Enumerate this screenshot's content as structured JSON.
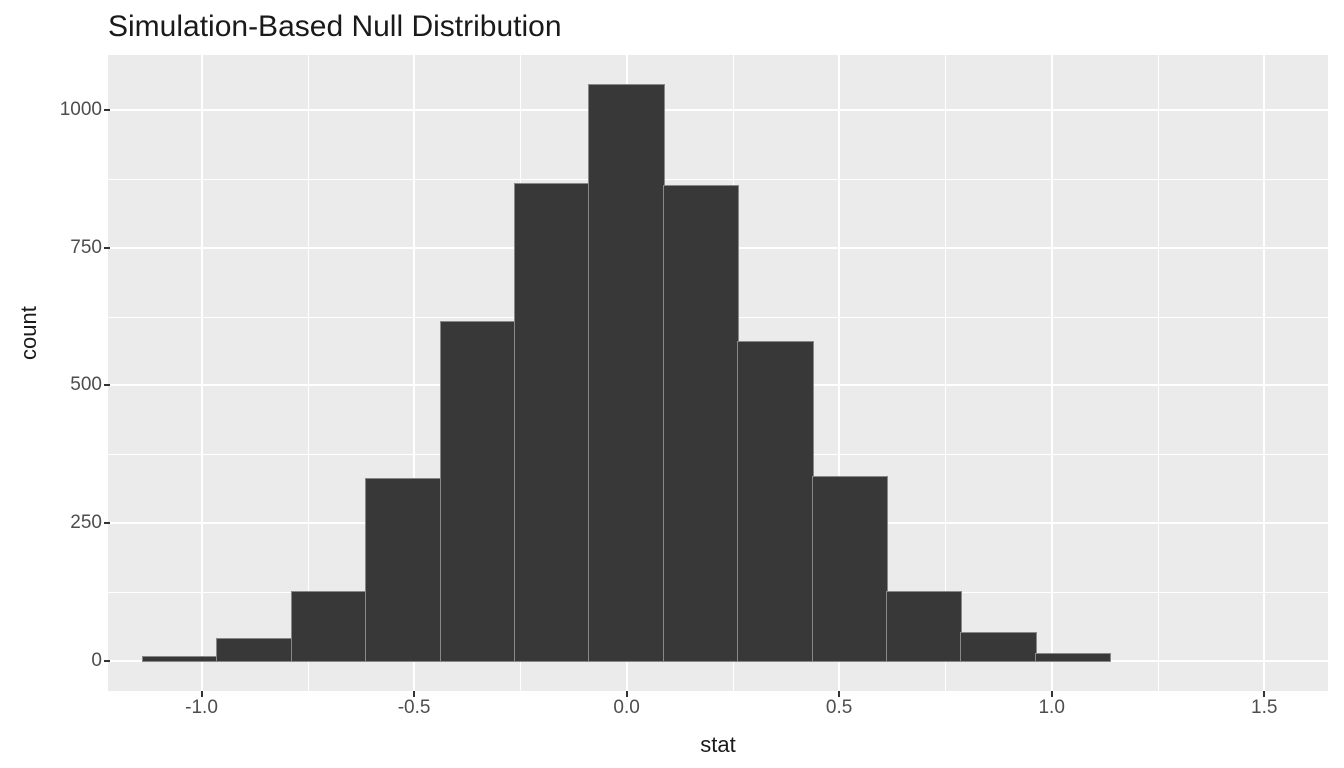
{
  "chart_data": {
    "type": "bar",
    "title": "Simulation-Based Null Distribution",
    "xlabel": "stat",
    "ylabel": "count",
    "xlim": [
      -1.22,
      1.65
    ],
    "ylim": [
      -55,
      1100
    ],
    "x_ticks": [
      -1.0,
      -0.5,
      0.0,
      0.5,
      1.0,
      1.5
    ],
    "y_ticks": [
      0,
      250,
      500,
      750,
      1000
    ],
    "bin_width": 0.175,
    "categories": [
      -1.05,
      -0.875,
      -0.7,
      -0.525,
      -0.35,
      -0.175,
      0.0,
      0.175,
      0.35,
      0.525,
      0.7,
      0.875,
      1.05
    ],
    "values": [
      7,
      40,
      125,
      330,
      615,
      865,
      1045,
      862,
      578,
      333,
      125,
      50,
      12
    ]
  }
}
